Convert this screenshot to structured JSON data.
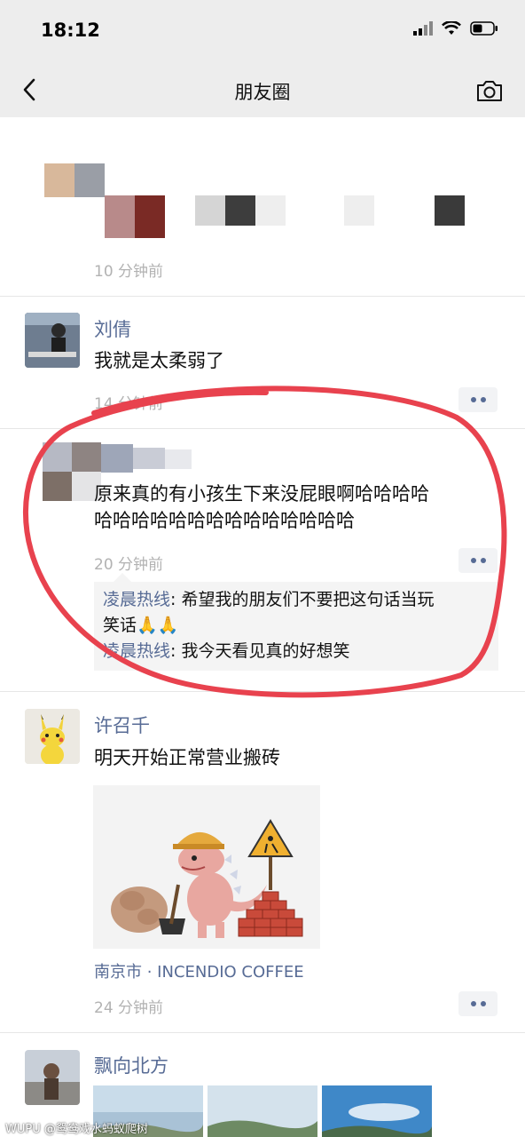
{
  "status_bar": {
    "time": "18:12"
  },
  "nav": {
    "title": "朋友圈"
  },
  "posts": [
    {
      "time": "10 分钟前"
    },
    {
      "name": "刘倩",
      "text": "我就是太柔弱了",
      "time": "14 分钟前"
    },
    {
      "text_line1": "原来真的有小孩生下来没屁眼啊哈哈哈哈",
      "text_line2": "哈哈哈哈哈哈哈哈哈哈哈哈哈哈",
      "time": "20 分钟前",
      "comments": [
        {
          "author": "凌晨热线",
          "sep": ": ",
          "line1": "希望我的朋友们不要把这句话当玩",
          "line2": "笑话🙏🙏"
        },
        {
          "author": "凌晨热线",
          "sep": ": ",
          "text": "我今天看见真的好想笑"
        }
      ]
    },
    {
      "name": "许召千",
      "text": "明天开始正常营业搬砖",
      "location": "南京市 · INCENDIO COFFEE",
      "time": "24 分钟前"
    },
    {
      "name": "飘向北方"
    }
  ],
  "watermark": "WUPU @鸳鸯戏水蚂蚁爬树",
  "colors": {
    "link": "#576b95",
    "annotation": "#e8424e",
    "nav_bg": "#ededed"
  }
}
